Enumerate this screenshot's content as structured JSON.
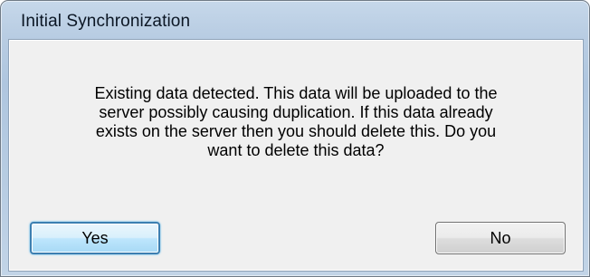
{
  "window": {
    "title": "Initial Synchronization"
  },
  "dialog": {
    "message_lines": [
      "Existing data detected. This data will be uploaded to the",
      "server possibly causing duplication. If this data already",
      "exists on the server then you should delete this. Do you",
      "want to delete this data?"
    ]
  },
  "buttons": {
    "yes_label": "Yes",
    "no_label": "No"
  },
  "colors": {
    "title_bar": "#b9cde3",
    "client_area": "#f0f0f0",
    "focused_button_border": "#3c7fb1"
  }
}
